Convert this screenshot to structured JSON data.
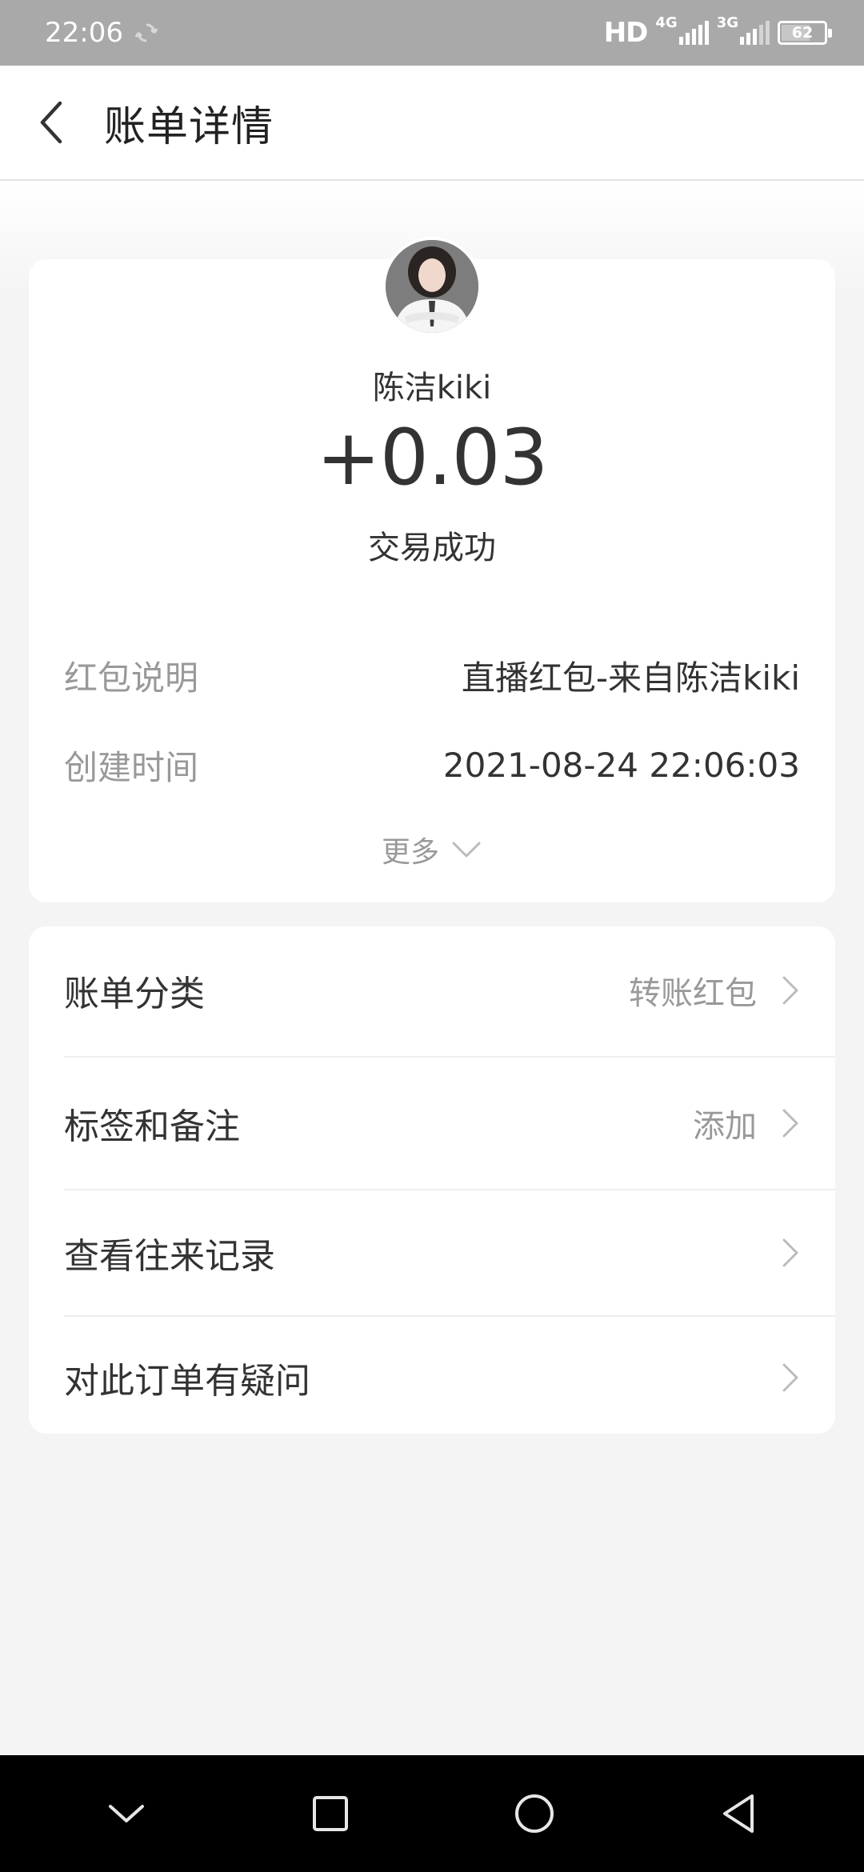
{
  "status_bar": {
    "time": "22:06",
    "network": "HD",
    "signal_1_tech": "4G",
    "signal_2_tech": "3G",
    "battery": "62"
  },
  "header": {
    "title": "账单详情"
  },
  "transaction": {
    "sender": "陈洁kiki",
    "amount": "+0.03",
    "status": "交易成功"
  },
  "details": [
    {
      "label": "红包说明",
      "value": "直播红包-来自陈洁kiki"
    },
    {
      "label": "创建时间",
      "value": "2021-08-24 22:06:03"
    }
  ],
  "more_label": "更多",
  "actions": [
    {
      "label": "账单分类",
      "value": "转账红包"
    },
    {
      "label": "标签和备注",
      "value": "添加"
    },
    {
      "label": "查看往来记录",
      "value": ""
    },
    {
      "label": "对此订单有疑问",
      "value": ""
    }
  ],
  "colors": {
    "status_bar": "#a9a9a9",
    "page_background": "#f4f4f4",
    "text_primary": "#333333",
    "text_secondary": "#999999"
  },
  "icons": {
    "back": "back-chevron-icon",
    "sync": "sync-icon",
    "more": "chevron-down-icon",
    "row_arrow": "chevron-right-icon",
    "nav_menu": "nav-chevron-down-icon",
    "nav_recents": "nav-square-icon",
    "nav_home": "nav-circle-icon",
    "nav_back": "nav-triangle-icon"
  }
}
